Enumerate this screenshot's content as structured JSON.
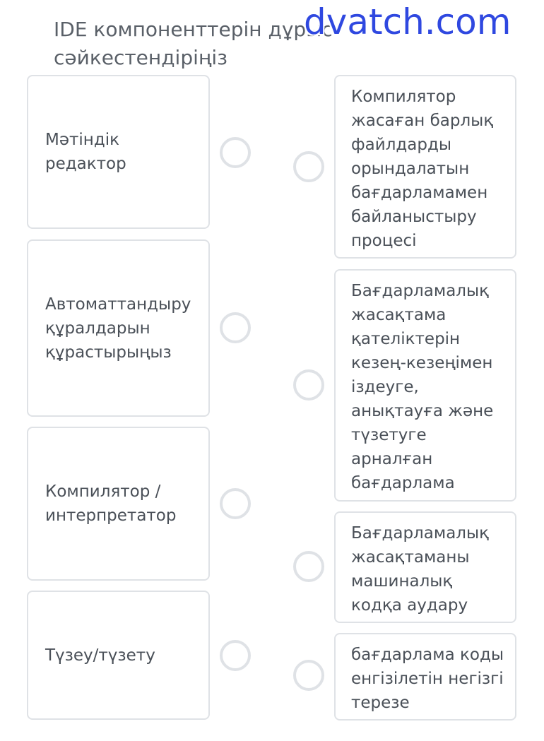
{
  "question": {
    "title": "IDE компоненттерін дұрыс сәйкестендіріңіз"
  },
  "watermark": "dvatch.com",
  "left_items": [
    {
      "label": "Мәтіндік редактор"
    },
    {
      "label": "Автоматтандыру құралдарын құрастырыңыз"
    },
    {
      "label": "Компилятор / интерпретатор"
    },
    {
      "label": "Түзеу/түзету"
    }
  ],
  "right_items": [
    {
      "label": "Компилятор жасаған барлық файлдарды орындалатын бағдарламамен байланыстыру процесі"
    },
    {
      "label": "Бағдарламалық жасақтама қателіктерін кезең-кезеңімен іздеуге, анықтауға және түзетуге арналған бағдарлама"
    },
    {
      "label": "Бағдарламалық жасақтаманы машиналық кодқа аудару"
    },
    {
      "label": "бағдарлама коды енгізілетін негізгі терезе"
    }
  ],
  "colors": {
    "border": "#dfe2e6",
    "text": "#4a5058",
    "watermark": "#2f48e0"
  }
}
